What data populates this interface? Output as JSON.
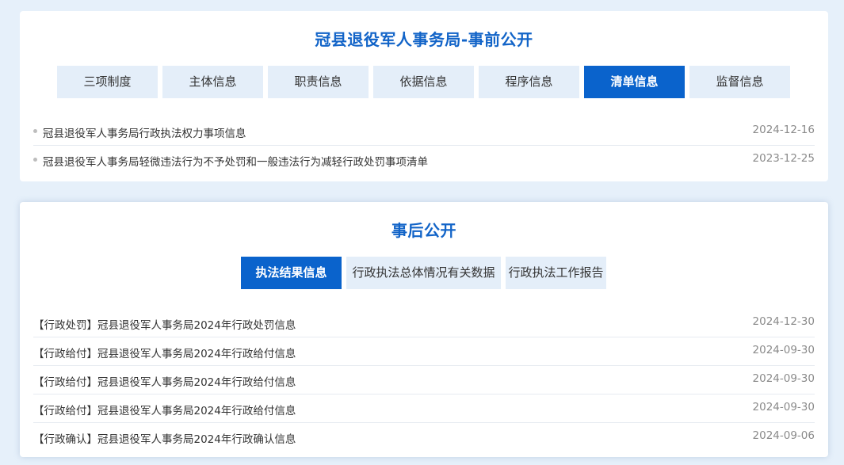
{
  "pre": {
    "title": "冠县退役军人事务局-事前公开",
    "tabs": [
      {
        "label": "三项制度"
      },
      {
        "label": "主体信息"
      },
      {
        "label": "职责信息"
      },
      {
        "label": "依据信息"
      },
      {
        "label": "程序信息"
      },
      {
        "label": "清单信息",
        "active": true
      },
      {
        "label": "监督信息"
      }
    ],
    "items": [
      {
        "title": "冠县退役军人事务局行政执法权力事项信息",
        "date": "2024-12-16"
      },
      {
        "title": "冠县退役军人事务局轻微违法行为不予处罚和一般违法行为减轻行政处罚事项清单",
        "date": "2023-12-25"
      }
    ]
  },
  "post": {
    "title": "事后公开",
    "tabs": [
      {
        "label": "执法结果信息",
        "active": true
      },
      {
        "label": "行政执法总体情况有关数据"
      },
      {
        "label": "行政执法工作报告"
      }
    ],
    "items": [
      {
        "title": "【行政处罚】冠县退役军人事务局2024年行政处罚信息",
        "date": "2024-12-30"
      },
      {
        "title": "【行政给付】冠县退役军人事务局2024年行政给付信息",
        "date": "2024-09-30"
      },
      {
        "title": "【行政给付】冠县退役军人事务局2024年行政给付信息",
        "date": "2024-09-30"
      },
      {
        "title": "【行政给付】冠县退役军人事务局2024年行政给付信息",
        "date": "2024-09-30"
      },
      {
        "title": "【行政确认】冠县退役军人事务局2024年行政确认信息",
        "date": "2024-09-06"
      }
    ]
  },
  "colors": {
    "accent": "#0a63cc",
    "title": "#1264c8",
    "tab_bg": "#e4eef9",
    "page_bg": "#e6f0fa"
  }
}
